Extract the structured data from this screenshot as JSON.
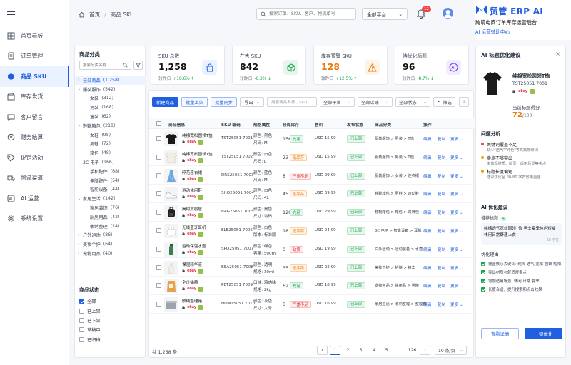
{
  "app": {
    "title": "贸管 ERP AI",
    "subtitle": "跨境电商订单库存运营后台",
    "tagline": "AI 运营辅助中心",
    "brand_color": "#1f5fe0"
  },
  "sidebar": {
    "items": [
      {
        "label": "首页看板",
        "icon": "dashboard-icon"
      },
      {
        "label": "订单管理",
        "icon": "order-icon"
      },
      {
        "label": "商品 SKU",
        "icon": "cube-icon",
        "active": true
      },
      {
        "label": "库存发货",
        "icon": "box-icon"
      },
      {
        "label": "客户留言",
        "icon": "message-icon"
      },
      {
        "label": "财务结算",
        "icon": "finance-icon"
      },
      {
        "label": "促销活动",
        "icon": "tag-icon"
      },
      {
        "label": "物流渠道",
        "icon": "truck-icon"
      },
      {
        "label": "AI 运营",
        "icon": "ai-icon"
      },
      {
        "label": "系统设置",
        "icon": "gear-icon"
      }
    ]
  },
  "header": {
    "breadcrumb_home": "首页",
    "breadcrumb_sep": "/",
    "breadcrumb_current": "商品 SKU",
    "search_placeholder": "搜索订单、SKU、客户、物流单号",
    "platform": "全部平台",
    "notif_count": "12"
  },
  "categories": {
    "title": "商品分类",
    "search_placeholder": "搜索分类名称",
    "items": [
      {
        "label": "全部商品",
        "count": "(1,258)",
        "level": 0,
        "arrow": "›",
        "selected": true
      },
      {
        "label": "服装服饰",
        "count": "(542)",
        "level": 0,
        "arrow": "⌄"
      },
      {
        "label": "女装",
        "count": "(312)",
        "level": 1
      },
      {
        "label": "男装",
        "count": "(168)",
        "level": 1
      },
      {
        "label": "童装",
        "count": "(62)",
        "level": 1
      },
      {
        "label": "鞋靴箱包",
        "count": "(218)",
        "level": 0,
        "arrow": "⌄"
      },
      {
        "label": "女鞋",
        "count": "(98)",
        "level": 1
      },
      {
        "label": "男鞋",
        "count": "(72)",
        "level": 1
      },
      {
        "label": "箱包",
        "count": "(48)",
        "level": 1
      },
      {
        "label": "3C 电子",
        "count": "(166)",
        "level": 0,
        "arrow": "⌄"
      },
      {
        "label": "手机配件",
        "count": "(68)",
        "level": 1
      },
      {
        "label": "电脑配件",
        "count": "(54)",
        "level": 1
      },
      {
        "label": "智能设备",
        "count": "(44)",
        "level": 1
      },
      {
        "label": "家居生活",
        "count": "(142)",
        "level": 0,
        "arrow": "⌄"
      },
      {
        "label": "家居装饰",
        "count": "(76)",
        "level": 1
      },
      {
        "label": "厨房用品",
        "count": "(42)",
        "level": 1
      },
      {
        "label": "收纳整理",
        "count": "(24)",
        "level": 1
      },
      {
        "label": "户外运动",
        "count": "(86)",
        "level": 0,
        "arrow": "›"
      },
      {
        "label": "美妆个护",
        "count": "(64)",
        "level": 0,
        "arrow": "›"
      },
      {
        "label": "宠物用品",
        "count": "(40)",
        "level": 0,
        "arrow": "›"
      }
    ],
    "status_title": "商品状态",
    "status": [
      {
        "label": "全部",
        "checked": true
      },
      {
        "label": "已上架"
      },
      {
        "label": "已下架"
      },
      {
        "label": "草稿中"
      },
      {
        "label": "已归档"
      }
    ]
  },
  "kpis": [
    {
      "label": "SKU 总数",
      "value": "1,258",
      "prefix": "较昨日",
      "change": "+18.6%",
      "dir": "↑",
      "color": "#1f5fe0",
      "bg": "#eaf1ff",
      "icon": "bag-icon",
      "vcolor": "#111"
    },
    {
      "label": "在售 SKU",
      "value": "842",
      "prefix": "较昨日",
      "change": "-6.3%",
      "dir": "↓",
      "color": "#16a34a",
      "bg": "#e6f6ec",
      "icon": "box-icon",
      "vcolor": "#111"
    },
    {
      "label": "库存预警 SKU",
      "value": "128",
      "prefix": "较昨日",
      "change": "+12.5%",
      "dir": "↑",
      "color": "#ea7b0c",
      "bg": "#fff3e6",
      "icon": "warning-icon",
      "vcolor": "#ea7b0c"
    },
    {
      "label": "待优化标题",
      "value": "96",
      "prefix": "较昨日",
      "change": "-8.7%",
      "dir": "↓",
      "color": "#7c3aed",
      "bg": "#f1ecfe",
      "icon": "ai-badge-icon",
      "vcolor": "#111"
    }
  ],
  "toolbar": {
    "new": "新建商品",
    "bulk_publish": "批量上架",
    "bulk_sync": "批量同步",
    "export": "导出",
    "search_placeholder": "搜索商品名称、SKU",
    "platform": "全部平台",
    "store": "全部店铺",
    "status": "全部状态",
    "filter": "筛选"
  },
  "table": {
    "headers": [
      "商品信息",
      "SKU 编码",
      "规格属性",
      "仓库库存",
      "售价",
      "发布状态",
      "商品分类",
      "操作"
    ],
    "rows": [
      {
        "name": "纯棉宽松圆领T恤",
        "sku": "TST25051 7001",
        "spec1": "颜色: 黑色",
        "spec2": "尺码: M",
        "stock": "156",
        "stag": "充足",
        "stype": "ok",
        "price": "USD 15.99",
        "pub": "已上架",
        "cat": "服装服饰 > 男装 > T恤",
        "img": "tshirt-black"
      },
      {
        "name": "纯棉宽松圆领T恤",
        "sku": "TST25051 7002",
        "spec1": "颜色: 白色",
        "spec2": "尺码: L",
        "stock": "23",
        "stag": "低库存",
        "stype": "low",
        "price": "USD 15.99",
        "pub": "已上架",
        "cat": "服装服饰 > 男装 > T恤",
        "img": "tshirt-white"
      },
      {
        "name": "碎花连衣裙",
        "sku": "DRS25051 7003",
        "spec1": "颜色: 蓝色",
        "spec2": "尺码: M",
        "stock": "8",
        "stag": "严重不足",
        "stype": "crit",
        "price": "USD 29.99",
        "pub": "已上架",
        "cat": "服装服饰 > 女装 > 连衣裙",
        "img": "dress"
      },
      {
        "name": "运动休闲鞋",
        "sku": "SHO25051 7004",
        "spec1": "颜色: 白色",
        "spec2": "尺码: 42",
        "stock": "45",
        "stag": "低库存",
        "stype": "low",
        "price": "USD 39.99",
        "pub": "已上架",
        "cat": "鞋靴箱包 > 男鞋 > 运动鞋",
        "img": "shoe"
      },
      {
        "name": "简约双肩包",
        "sku": "BAG25051 7005",
        "spec1": "颜色: 黑色",
        "spec2": "尺寸: 均码",
        "stock": "120",
        "stag": "充足",
        "stype": "ok",
        "price": "USD 29.99",
        "pub": "已上架",
        "cat": "鞋靴箱包 > 箱包 > 双肩包",
        "img": "backpack"
      },
      {
        "name": "无线蓝牙耳机",
        "sku": "ELE25051 7006",
        "spec1": "颜色: 白色",
        "spec2": "版本: 标准版",
        "stock": "18",
        "stag": "低库存",
        "stype": "low",
        "price": "USD 24.99",
        "pub": "已上架",
        "cat": "3C 电子 > 智能设备 > 耳机",
        "img": "earbuds"
      },
      {
        "name": "运动保温水壶",
        "sku": "SPO25051 7007",
        "spec1": "颜色: 绿色",
        "spec2": "容量: 500ml",
        "stock": "0",
        "stag": "缺货",
        "stype": "out",
        "price": "USD 19.99",
        "pub": "已上架",
        "cat": "户外运动 > 运动装备 > 水壶",
        "img": "bottle"
      },
      {
        "name": "保湿精华液",
        "sku": "BEA25051 7008",
        "spec1": "颜色: 透明",
        "spec2": "规格: 30ml",
        "stock": "35",
        "stag": "低库存",
        "stype": "low",
        "price": "USD 22.99",
        "pub": "已上架",
        "cat": "美妆个护 > 护肤 > 精华",
        "img": "serum"
      },
      {
        "name": "全价猫粮",
        "sku": "PET25051 7009",
        "spec1": "口味: 鸡肉味",
        "spec2": "规格: 2kg",
        "stock": "62",
        "stag": "充足",
        "stype": "ok",
        "price": "USD 18.99",
        "pub": "已上架",
        "cat": "宠物用品 > 猫用品 > 猫粮",
        "img": "catfood"
      },
      {
        "name": "收纳整理箱",
        "sku": "HOM25051 7010",
        "spec1": "颜色: 灰色",
        "spec2": "尺寸: 大号",
        "stock": "5",
        "stag": "严重不足",
        "stype": "crit",
        "price": "USD 16.99",
        "pub": "已上架",
        "cat": "家居生活 > 收纳整理 > 整理箱",
        "img": "storage"
      }
    ],
    "actions": [
      "编辑",
      "复制",
      "更多"
    ]
  },
  "footer": {
    "total": "共 1,258 条",
    "pages": [
      "1",
      "2",
      "3",
      "4",
      "5",
      "...",
      "126"
    ],
    "page_size": "10 条/页"
  },
  "ai_panel": {
    "title": "AI 标题优化建议",
    "close": "×",
    "product_name": "纯棉宽松圆领T恤",
    "product_sku": "TST25051 7001",
    "score_label": "当前标题得分",
    "score": "72",
    "score_max": "/100",
    "analysis_title": "问题分析",
    "issues": [
      {
        "title": "关键词覆盖不足",
        "desc": "缺少\"透气\"\"纯色\"等高频搜索词",
        "color": "#ef4444"
      },
      {
        "title": "卖点不够突出",
        "desc": "未体现材质、版型、适用场景等卖点",
        "color": "#f59e0b"
      },
      {
        "title": "标题长度偏短",
        "desc": "建议优化至 60-80 字符效果更佳",
        "color": "#f59e0b"
      }
    ],
    "suggest_title": "AI 优化建议",
    "rec_label": "推荐标题",
    "rec_badge": "AI",
    "rec_text": "纯棉透气宽松圆领T恤 男士夏季纯色短袖休闲日常舒适上衣",
    "rec_count": "68 字符",
    "points_title": "优化理由",
    "points": [
      "覆盖核心关键词: 纯棉 透气 宽松 圆领 短袖",
      "突出材质与舒适度卖点",
      "增加适用场景: 休闲 日常 夏季",
      "长度合适，提升搜索和点击效果"
    ],
    "btn_detail": "查看详情",
    "btn_apply": "一键优化"
  }
}
